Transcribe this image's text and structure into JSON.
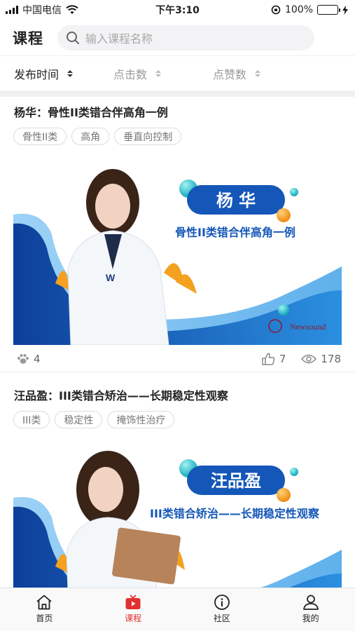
{
  "status_bar": {
    "carrier": "中国电信",
    "time": "下午3:10",
    "battery": "100%"
  },
  "header": {
    "title": "课程",
    "search_placeholder": "输入课程名称"
  },
  "sort": [
    {
      "label": "发布时间"
    },
    {
      "label": "点击数"
    },
    {
      "label": "点赞数"
    }
  ],
  "courses": [
    {
      "title": "杨华：骨性II类错合伴高角一例",
      "tags": [
        "骨性II类",
        "高角",
        "垂直向控制"
      ],
      "banner": {
        "name": "杨 华",
        "subtitle": "骨性II类错合伴高角一例",
        "brand": "Newsound"
      },
      "paw_count": "4",
      "likes": "7",
      "views": "178"
    },
    {
      "title": "汪品盈：III类错合矫治——长期稳定性观察",
      "tags": [
        "III类",
        "稳定性",
        "掩饰性治疗"
      ],
      "banner": {
        "name": "汪品盈",
        "subtitle": "III类错合矫治——长期稳定性观察"
      }
    }
  ],
  "tabs": [
    {
      "label": "首页",
      "icon": "home-icon"
    },
    {
      "label": "课程",
      "icon": "video-icon"
    },
    {
      "label": "社区",
      "icon": "info-icon"
    },
    {
      "label": "我的",
      "icon": "user-icon"
    }
  ],
  "colors": {
    "accent": "#e0312f",
    "brand_blue": "#1457b8",
    "light_blue": "#6fb7ee"
  }
}
